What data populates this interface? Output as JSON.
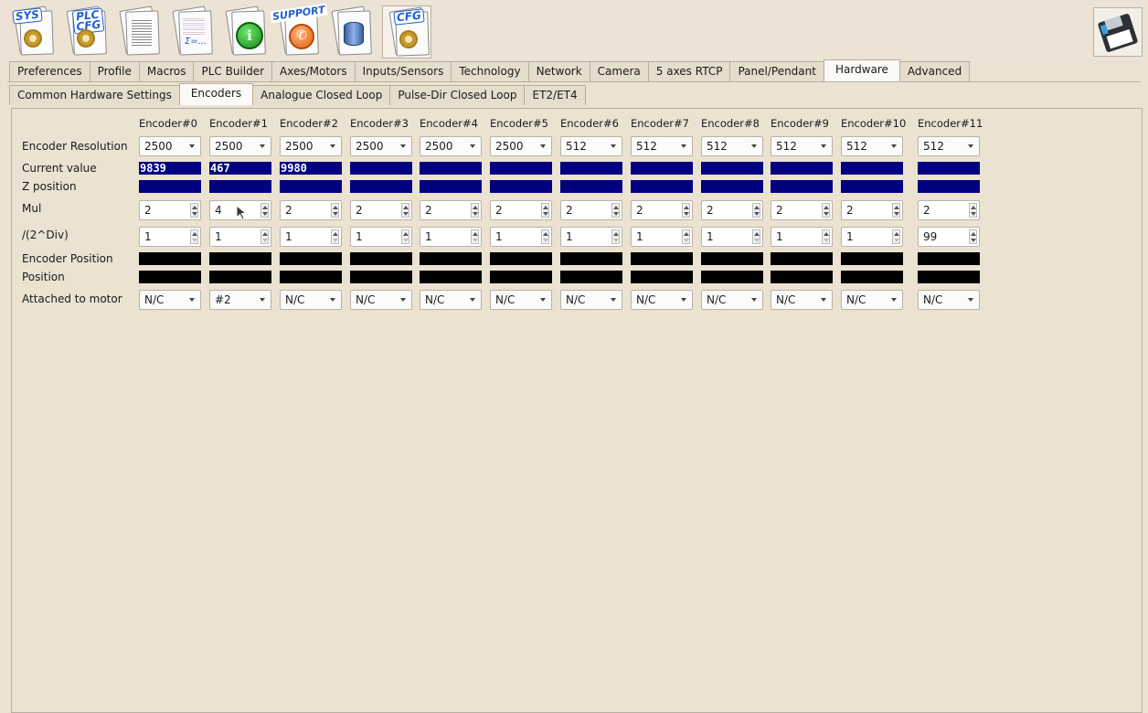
{
  "toolbar": {
    "sys_label": "SYS",
    "plc_label": "PLC\nCFG",
    "support_label": "SUPPORT",
    "cfg_label": "CFG",
    "sigma_label": "Σ=..."
  },
  "main_tabs": [
    "Preferences",
    "Profile",
    "Macros",
    "PLC Builder",
    "Axes/Motors",
    "Inputs/Sensors",
    "Technology",
    "Network",
    "Camera",
    "5 axes RTCP",
    "Panel/Pendant",
    "Hardware",
    "Advanced"
  ],
  "sub_tabs": [
    "Common Hardware Settings",
    "Encoders",
    "Analogue Closed Loop",
    "Pulse-Dir Closed Loop",
    "ET2/ET4"
  ],
  "row_labels": {
    "resolution": "Encoder Resolution",
    "current": "Current value",
    "z": "Z position",
    "mul": "Mul",
    "div": "/(2^Div)",
    "encpos": "Encoder Position",
    "pos": "Position",
    "motor": "Attached to motor"
  },
  "encoders": [
    {
      "name": "Encoder#0",
      "resolution": "2500",
      "current": "9839",
      "mul": "2",
      "div": "1",
      "motor": "N/C"
    },
    {
      "name": "Encoder#1",
      "resolution": "2500",
      "current": "467",
      "mul": "4",
      "div": "1",
      "motor": "#2"
    },
    {
      "name": "Encoder#2",
      "resolution": "2500",
      "current": "9980",
      "mul": "2",
      "div": "1",
      "motor": "N/C"
    },
    {
      "name": "Encoder#3",
      "resolution": "2500",
      "current": "",
      "mul": "2",
      "div": "1",
      "motor": "N/C"
    },
    {
      "name": "Encoder#4",
      "resolution": "2500",
      "current": "",
      "mul": "2",
      "div": "1",
      "motor": "N/C"
    },
    {
      "name": "Encoder#5",
      "resolution": "2500",
      "current": "",
      "mul": "2",
      "div": "1",
      "motor": "N/C"
    },
    {
      "name": "Encoder#6",
      "resolution": "512",
      "current": "",
      "mul": "2",
      "div": "1",
      "motor": "N/C"
    },
    {
      "name": "Encoder#7",
      "resolution": "512",
      "current": "",
      "mul": "2",
      "div": "1",
      "motor": "N/C"
    },
    {
      "name": "Encoder#8",
      "resolution": "512",
      "current": "",
      "mul": "2",
      "div": "1",
      "motor": "N/C"
    },
    {
      "name": "Encoder#9",
      "resolution": "512",
      "current": "",
      "mul": "2",
      "div": "1",
      "motor": "N/C"
    },
    {
      "name": "Encoder#10",
      "resolution": "512",
      "current": "",
      "mul": "2",
      "div": "1",
      "motor": "N/C"
    },
    {
      "name": "Encoder#11",
      "resolution": "512",
      "current": "",
      "mul": "2",
      "div": "99",
      "motor": "N/C"
    }
  ],
  "colors": {
    "value_bar": "#000080",
    "position_bar": "#000000",
    "background": "#ebe2d2"
  }
}
